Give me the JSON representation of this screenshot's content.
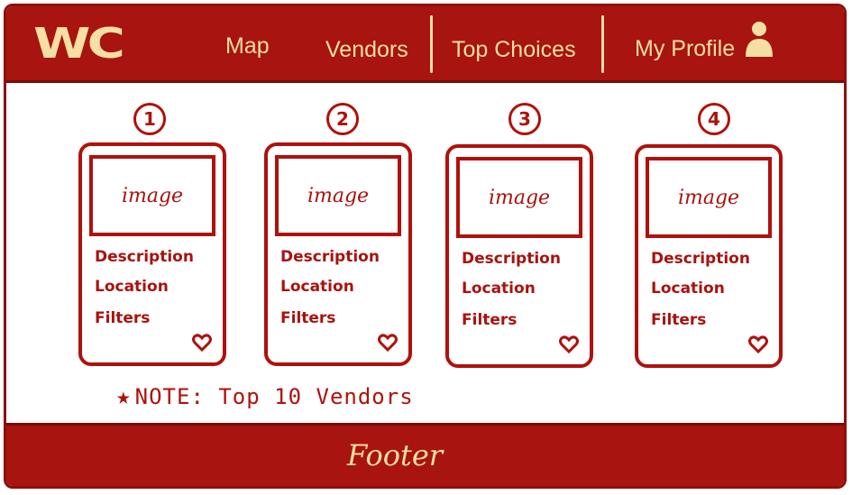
{
  "brand": {
    "logo": "WC"
  },
  "nav": {
    "map": "Map",
    "vendors": "Vendors",
    "top_choices": "Top Choices",
    "my_profile": "My Profile",
    "profile_icon": "user-icon"
  },
  "cards": [
    {
      "number": "1",
      "image": "image",
      "description": "Description",
      "location": "Location",
      "filters": "Filters",
      "icon": "heart-icon"
    },
    {
      "number": "2",
      "image": "image",
      "description": "Description",
      "location": "Location",
      "filters": "Filters",
      "icon": "heart-icon"
    },
    {
      "number": "3",
      "image": "image",
      "description": "Description",
      "location": "Location",
      "filters": "Filters",
      "icon": "heart-icon"
    },
    {
      "number": "4",
      "image": "image",
      "description": "Description",
      "location": "Location",
      "filters": "Filters",
      "icon": "heart-icon"
    }
  ],
  "note": {
    "star": "★",
    "text": "NOTE: Top 10 Vendors"
  },
  "footer": {
    "text": "Footer"
  },
  "colors": {
    "primary": "#a8140f",
    "accent": "#f6dfa4",
    "ink": "#b0110c",
    "background": "#ffffff"
  }
}
